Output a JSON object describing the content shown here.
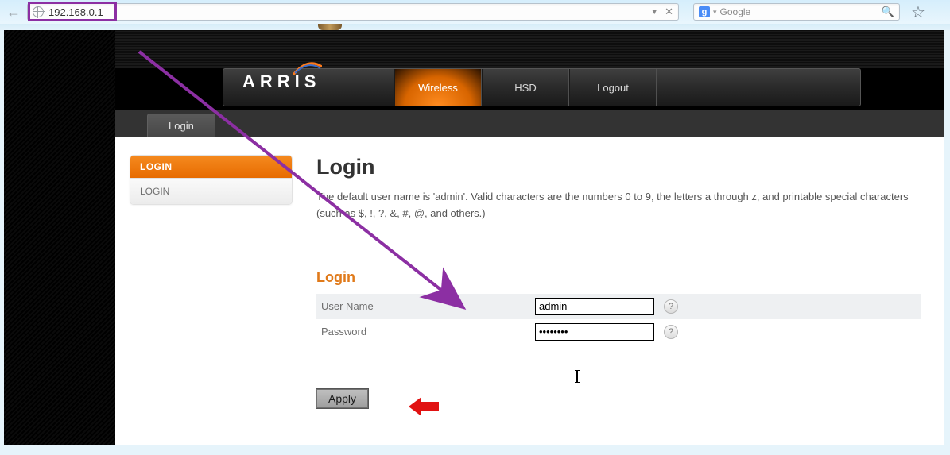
{
  "browser": {
    "url": "192.168.0.1",
    "search_provider_icon": "g",
    "search_placeholder": "Google"
  },
  "brand": "ARRIS",
  "nav": {
    "wireless": "Wireless",
    "hsd": "HSD",
    "logout": "Logout"
  },
  "subnav": {
    "login_tab": "Login"
  },
  "sidebar": {
    "header": "LOGIN",
    "link_login": "LOGIN"
  },
  "page": {
    "title": "Login",
    "intro": "The default user name is 'admin'. Valid characters are the numbers 0 to 9, the letters a through z, and printable special characters (such as $, !, ?, &, #, @, and others.)",
    "section": "Login",
    "username_label": "User Name",
    "password_label": "Password",
    "username_value": "admin",
    "password_value": "••••••••",
    "help_glyph": "?",
    "apply": "Apply"
  }
}
